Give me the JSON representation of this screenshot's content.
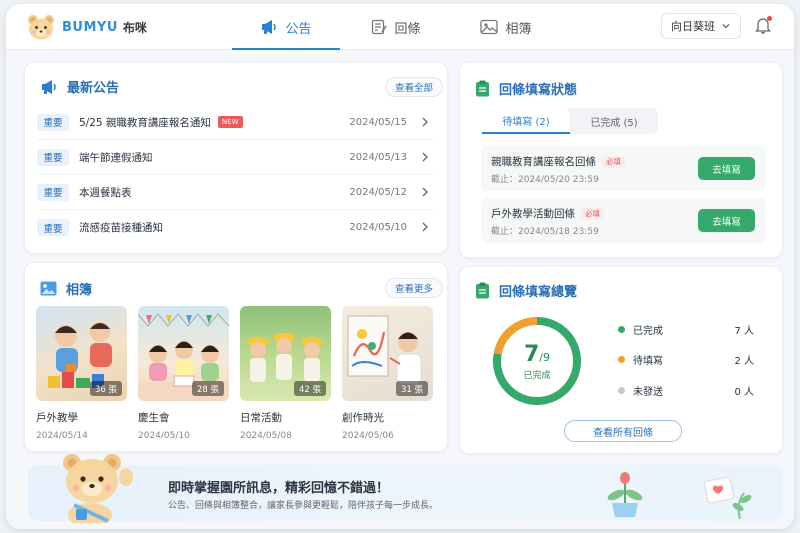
{
  "app": {
    "brand_en": "BUMYU",
    "brand_zh": "布咪"
  },
  "nav": {
    "tabs": [
      {
        "label": "公告",
        "icon": "megaphone-icon",
        "active": true
      },
      {
        "label": "回條",
        "icon": "form-icon",
        "active": false
      },
      {
        "label": "相簿",
        "icon": "photo-album-icon",
        "active": false
      }
    ]
  },
  "header": {
    "class_selected": "向日葵班",
    "notification_icon": "bell-icon"
  },
  "announcements": {
    "title": "最新公告",
    "view_all": "查看全部",
    "items": [
      {
        "tag": "重要",
        "title": "5/25 親職教育講座報名通知",
        "badge": "NEW",
        "date": "2024/05/15"
      },
      {
        "tag": "重要",
        "title": "端午節連假通知",
        "date": "2024/05/13"
      },
      {
        "tag": "重要",
        "title": "本週餐點表",
        "date": "2024/05/12"
      },
      {
        "tag": "重要",
        "title": "流感疫苗接種通知",
        "date": "2024/05/10"
      }
    ]
  },
  "album": {
    "title": "相簿",
    "view_more": "查看更多",
    "items": [
      {
        "name": "戶外教學",
        "date": "2024/05/14",
        "count": "36 張"
      },
      {
        "name": "慶生會",
        "date": "2024/05/10",
        "count": "28 張"
      },
      {
        "name": "日常活動",
        "date": "2024/05/08",
        "count": "42 張"
      },
      {
        "name": "創作時光",
        "date": "2024/05/06",
        "count": "31 張"
      }
    ]
  },
  "reply_status": {
    "title": "回條填寫狀態",
    "tabs": [
      {
        "label": "待填寫 (2)",
        "active": true
      },
      {
        "label": "已完成 (5)",
        "active": false
      }
    ],
    "items": [
      {
        "title": "親職教育講座報名回條",
        "required": "必填",
        "deadline": "截止：2024/05/20 23:59",
        "action": "去填寫"
      },
      {
        "title": "戶外教學活動回條",
        "required": "必填",
        "deadline": "截止：2024/05/18 23:59",
        "action": "去填寫"
      }
    ]
  },
  "overview": {
    "title": "回條填寫總覽",
    "done": "7",
    "total": "/9",
    "center_label": "已完成",
    "progress_fraction": 0.778,
    "legend": [
      {
        "label": "已完成",
        "value": "7 人",
        "color": "#35a86b"
      },
      {
        "label": "待填寫",
        "value": "2 人",
        "color": "#f0a030"
      },
      {
        "label": "未發送",
        "value": "0 人",
        "color": "#c4c9cf"
      }
    ],
    "view_all": "查看所有回條"
  },
  "banner": {
    "title": "即時掌握園所訊息，精彩回憶不錯過！",
    "subtitle": "公告、回條與相簿整合，讓家長參與更輕鬆，陪伴孩子每一步成長。"
  },
  "colors": {
    "primary": "#2a7fd4",
    "success": "#35a86b",
    "pending": "#f0a030",
    "danger": "#e45454"
  }
}
